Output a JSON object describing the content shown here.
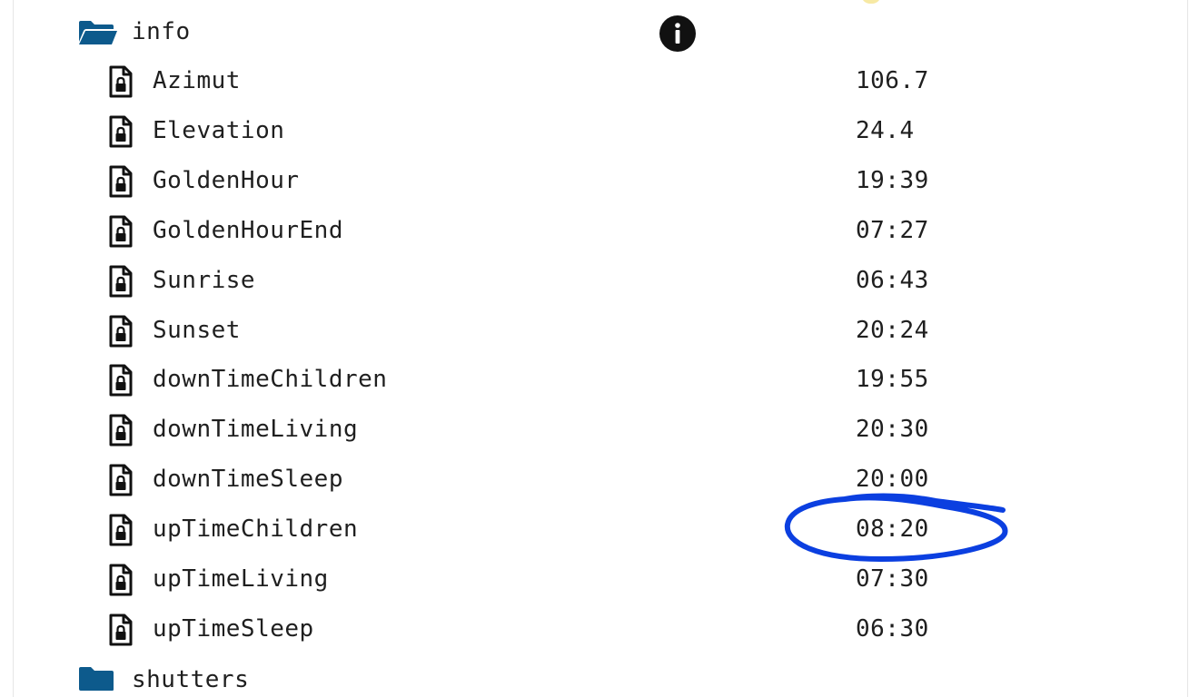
{
  "tree": {
    "info_folder": {
      "label": "info",
      "icon": "folder-open-icon",
      "action_icon": "info-icon"
    },
    "items": [
      {
        "name": "Azimut",
        "value": "106.7",
        "icon": "locked-file-icon"
      },
      {
        "name": "Elevation",
        "value": "24.4",
        "icon": "locked-file-icon"
      },
      {
        "name": "GoldenHour",
        "value": "19:39",
        "icon": "locked-file-icon"
      },
      {
        "name": "GoldenHourEnd",
        "value": "07:27",
        "icon": "locked-file-icon"
      },
      {
        "name": "Sunrise",
        "value": "06:43",
        "icon": "locked-file-icon"
      },
      {
        "name": "Sunset",
        "value": "20:24",
        "icon": "locked-file-icon"
      },
      {
        "name": "downTimeChildren",
        "value": "19:55",
        "icon": "locked-file-icon"
      },
      {
        "name": "downTimeLiving",
        "value": "20:30",
        "icon": "locked-file-icon"
      },
      {
        "name": "downTimeSleep",
        "value": "20:00",
        "icon": "locked-file-icon"
      },
      {
        "name": "upTimeChildren",
        "value": "08:20",
        "icon": "locked-file-icon"
      },
      {
        "name": "upTimeLiving",
        "value": "07:30",
        "icon": "locked-file-icon"
      },
      {
        "name": "upTimeSleep",
        "value": "06:30",
        "icon": "locked-file-icon"
      }
    ],
    "shutters_folder": {
      "label": "shutters",
      "icon": "folder-closed-icon"
    }
  },
  "colors": {
    "folder": "#0d5a8c",
    "text": "#1f1f1f",
    "highlight_ink": "#0b3fe0"
  }
}
